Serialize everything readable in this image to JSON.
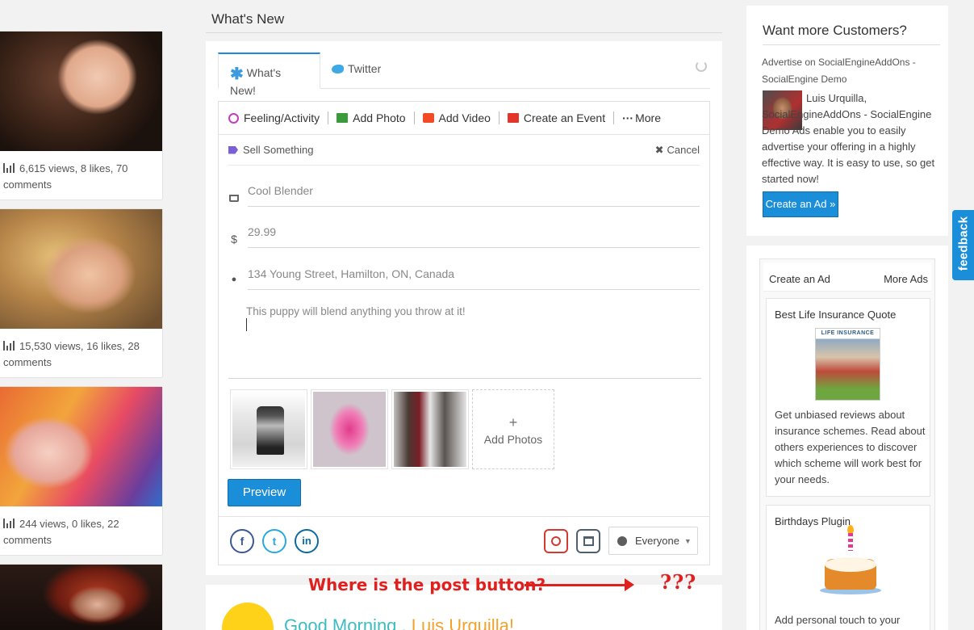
{
  "left_photos": [
    {
      "stats": "6,615 views, 8 likes, 70 comments"
    },
    {
      "stats": "15,530 views, 16 likes, 28 comments"
    },
    {
      "stats": "244 views, 0 likes, 22 comments"
    }
  ],
  "main": {
    "title": "What's New",
    "tabs": [
      {
        "label": "What's New!",
        "icon": "asterisk-icon"
      },
      {
        "label": "Twitter",
        "icon": "twitter-bird-icon"
      }
    ],
    "actions": [
      {
        "label": "Feeling/Activity",
        "icon": "smiley-icon"
      },
      {
        "label": "Add Photo",
        "icon": "photo-icon"
      },
      {
        "label": "Add Video",
        "icon": "video-icon"
      },
      {
        "label": "Create an Event",
        "icon": "calendar-icon"
      },
      {
        "label": "More",
        "icon": "ellipsis-icon"
      }
    ],
    "sell": {
      "label": "Sell Something",
      "cancel": "Cancel",
      "product": "Cool Blender",
      "price": "29.99",
      "price_symbol": "$",
      "location": "134 Young Street, Hamilton, ON, Canada",
      "description": "This puppy will blend anything you throw at it!"
    },
    "add_photos": "Add Photos",
    "add_plus": "+",
    "preview": "Preview",
    "social": {
      "facebook": "f",
      "twitter": "t",
      "linkedin": "in"
    },
    "privacy": "Everyone",
    "annotation": "Where is the post button?",
    "annotation_marks": "???",
    "greeting": "Good Morning ,",
    "greeting_name": "Luis Urquilla!"
  },
  "right": {
    "ad_title": "Want more Customers?",
    "ad_sub": "Advertise on SocialEngineAddOns - SocialEngine Demo",
    "ad_body": "Luis Urquilla, SocialEngineAddOns - SocialEngine Demo Ads enable you to easily advertise your offering in a highly effective way. It is easy to use, so get started now!",
    "create_ad_button": "Create an Ad »",
    "ads_header_left": "Create an Ad",
    "ads_header_right": "More Ads",
    "card1_title": "Best Life Insurance Quote",
    "card1_image_label": "LIFE INSURANCE",
    "card1_desc": "Get unbiased reviews about insurance schemes. Read about others experiences to discover which scheme will work best for your needs.",
    "card2_title": "Birthdays Plugin",
    "card2_desc": "Add personal touch to your"
  },
  "feedback": "feedback",
  "colors": {
    "accent": "#1a8ed9",
    "annotation": "#e01f1f"
  }
}
